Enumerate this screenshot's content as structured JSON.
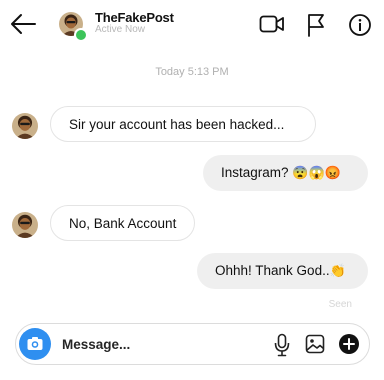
{
  "header": {
    "username": "TheFakePost",
    "status": "Active Now",
    "icons": [
      "back-arrow-icon",
      "video-camera-icon",
      "flag-icon",
      "info-icon"
    ]
  },
  "timestamp": "Today 5:13 PM",
  "messages": [
    {
      "direction": "in",
      "text": "Sir your account has been hacked..."
    },
    {
      "direction": "out",
      "text": "Instagram? ",
      "emoji": "😨😱😡"
    },
    {
      "direction": "in",
      "text": "No, Bank Account"
    },
    {
      "direction": "out",
      "text": "Ohhh! Thank God..",
      "emoji": "👏"
    }
  ],
  "seen_label": "Seen",
  "composer": {
    "placeholder": "Message...",
    "icons": [
      "camera-icon",
      "microphone-icon",
      "image-icon",
      "plus-icon"
    ]
  },
  "colors": {
    "camera_button": "#2f8ff0",
    "online_dot": "#3cc45a",
    "outgoing_bubble": "#efefef"
  }
}
